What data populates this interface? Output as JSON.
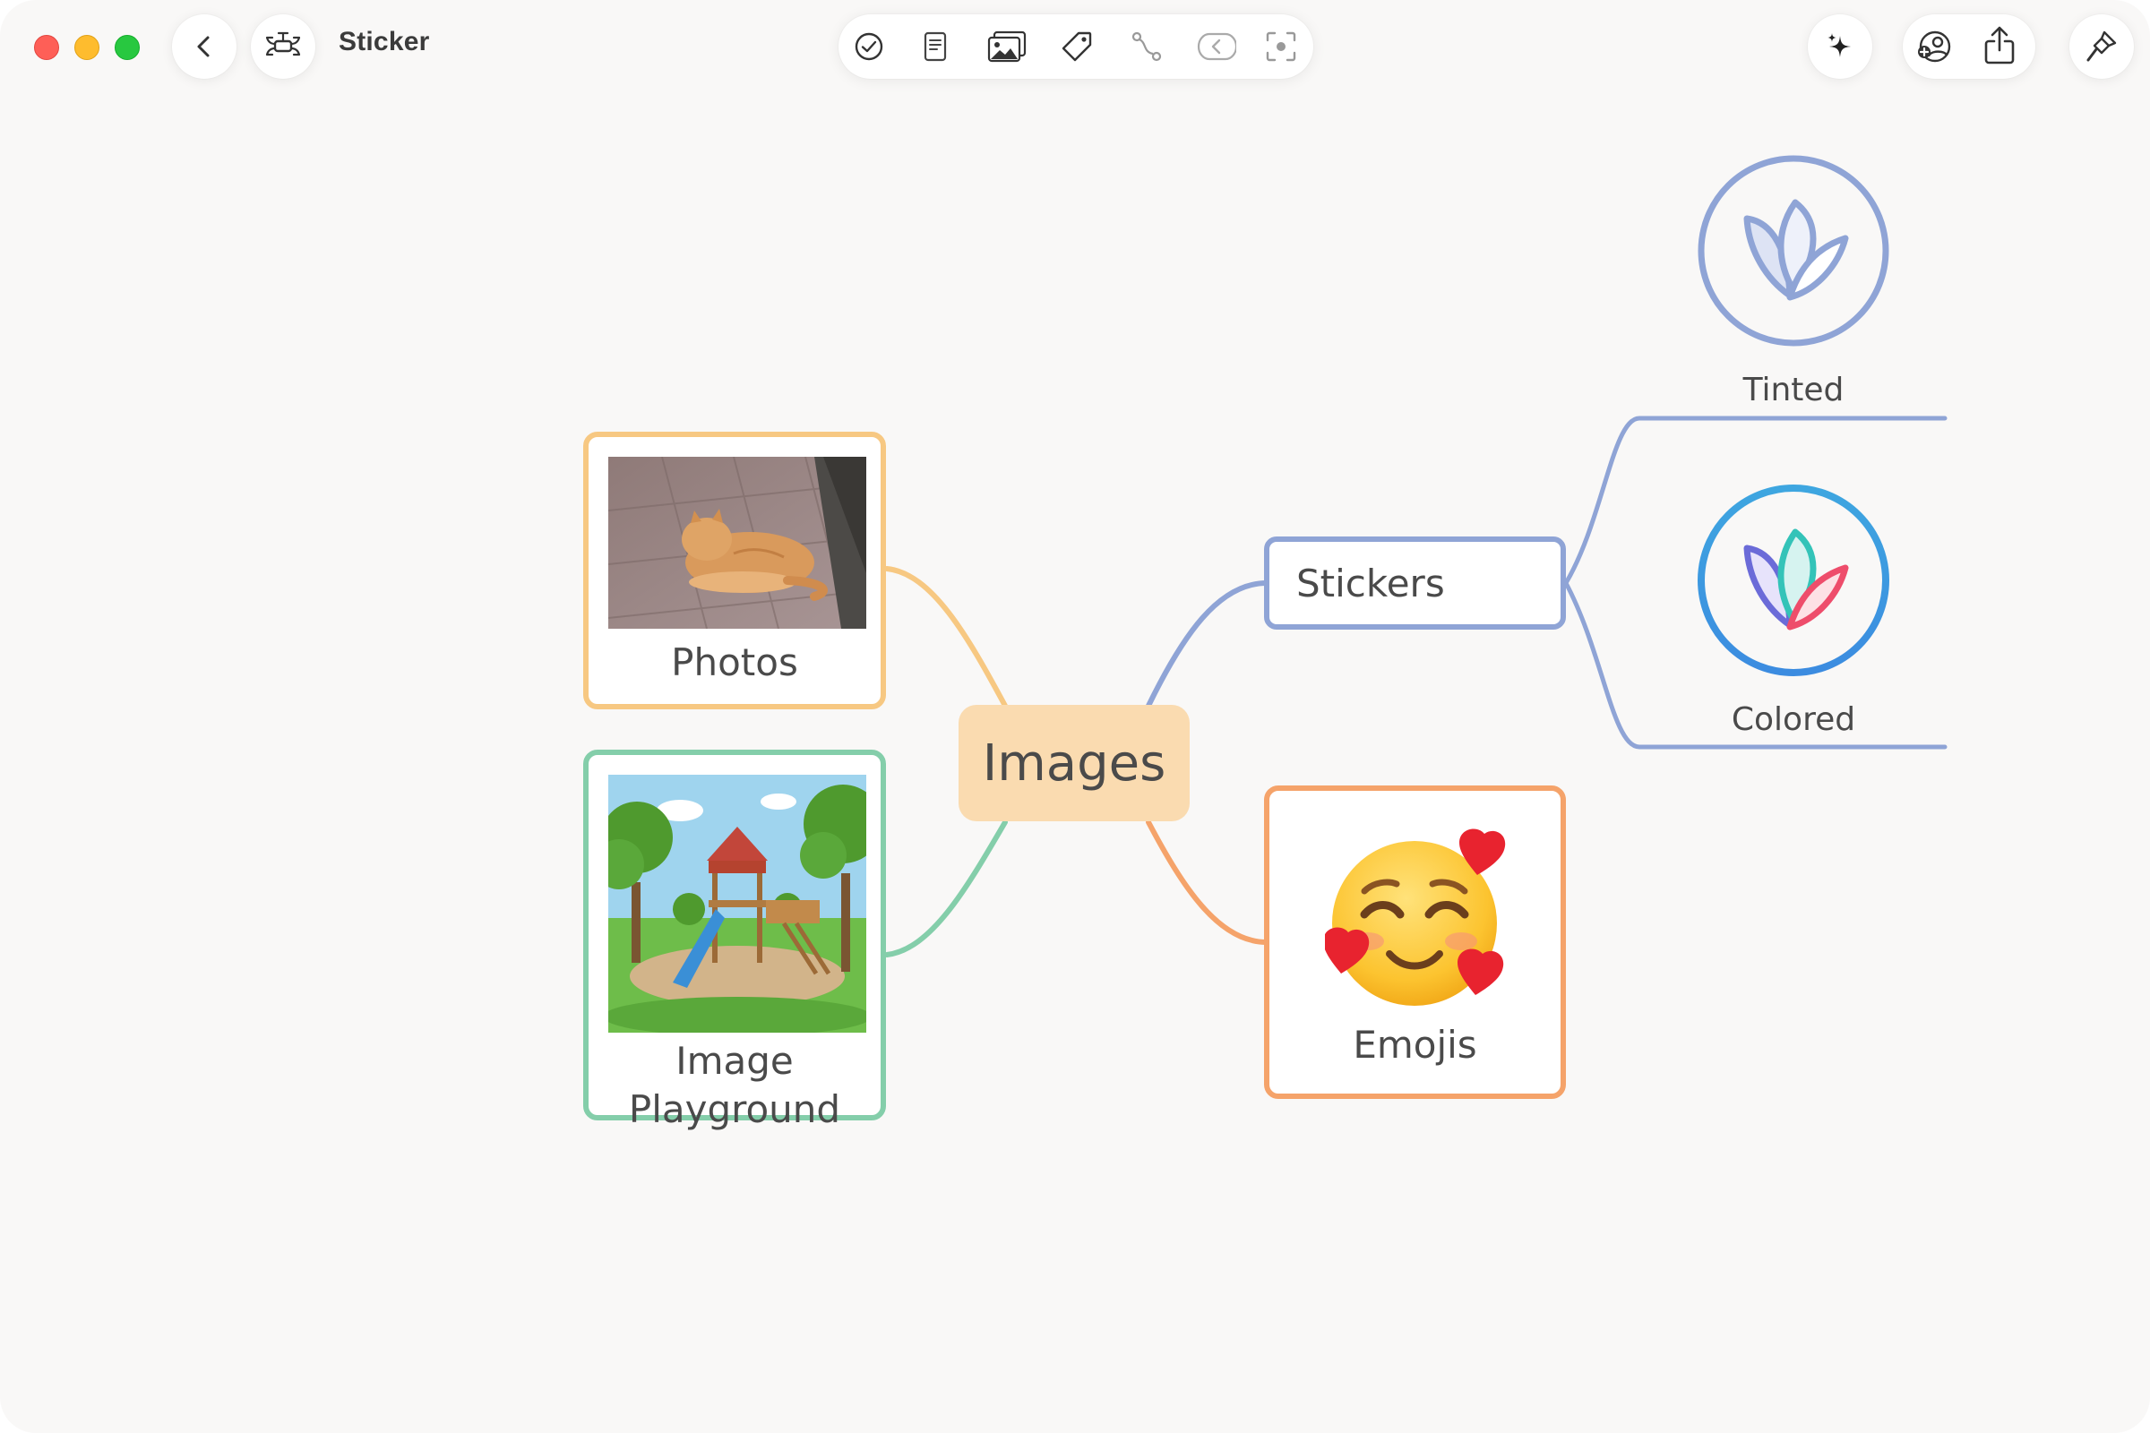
{
  "window": {
    "title": "Sticker"
  },
  "titlebar": {
    "back_icon": "chevron-left-icon",
    "mindmap_icon": "mindmap-icon",
    "toolbar_icons": [
      "checkmark-circle-icon",
      "note-icon",
      "image-icon",
      "tag-icon",
      "relationship-icon",
      "boundary-icon",
      "focus-icon"
    ],
    "right_icons": [
      "sparkle-icon",
      "collaborate-icon",
      "share-icon",
      "format-brush-icon"
    ]
  },
  "mindmap": {
    "central": "Images",
    "photos": {
      "label": "Photos",
      "color": "#f7c882"
    },
    "playground": {
      "label_line1": "Image",
      "label_line2": "Playground",
      "color": "#84ceaa"
    },
    "stickers": {
      "label": "Stickers",
      "color": "#8fa4d6"
    },
    "tinted": {
      "label": "Tinted"
    },
    "colored": {
      "label": "Colored"
    },
    "emojis": {
      "label": "Emojis",
      "color": "#f5a36a"
    }
  }
}
